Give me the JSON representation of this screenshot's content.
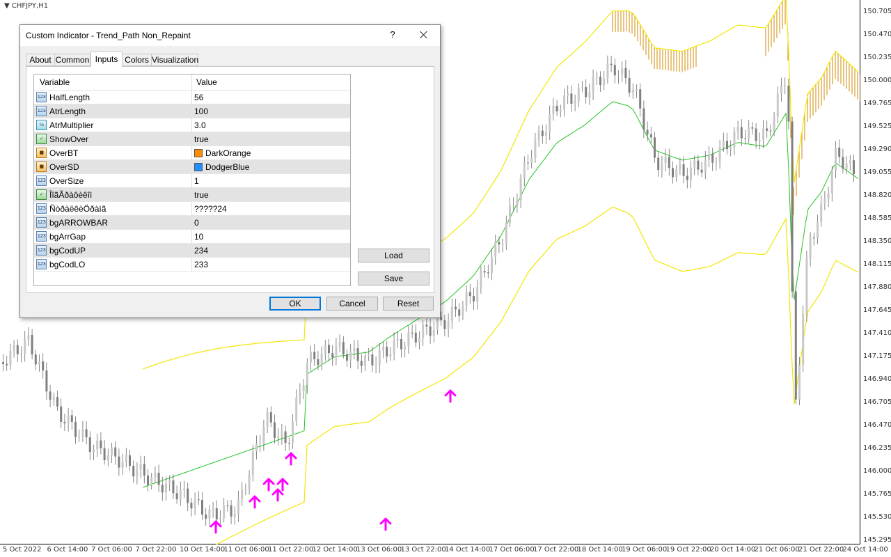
{
  "chart": {
    "symbol": "CHFJPY,H1",
    "price_axis": [
      "150.705",
      "150.470",
      "150.235",
      "150.000",
      "149.765",
      "149.525",
      "149.290",
      "149.055",
      "148.820",
      "148.585",
      "148.350",
      "148.115",
      "147.880",
      "147.645",
      "147.410",
      "147.175",
      "146.940",
      "146.705",
      "146.470",
      "146.235",
      "146.000",
      "145.765",
      "145.530",
      "145.295"
    ],
    "time_axis": [
      "5 Oct 2022",
      "6 Oct 14:00",
      "7 Oct 06:00",
      "7 Oct 22:00",
      "10 Oct 14:00",
      "11 Oct 06:00",
      "11 Oct 22:00",
      "12 Oct 14:00",
      "13 Oct 06:00",
      "13 Oct 22:00",
      "14 Oct 14:00",
      "17 Oct 06:00",
      "17 Oct 22:00",
      "18 Oct 14:00",
      "19 Oct 06:00",
      "19 Oct 22:00",
      "20 Oct 14:00",
      "21 Oct 06:00",
      "21 Oct 22:00",
      "24 Oct 14:00"
    ],
    "colors": {
      "upper_band": "#f2e600",
      "lower_band": "#f2e600",
      "mid_line": "#22c322",
      "over_bought": "#d08a00",
      "over_sold": "#1a8a94",
      "arrow": "#ff00ff",
      "candle_up": "#c8c8c8",
      "candle_down": "#808080"
    }
  },
  "dialog": {
    "title": "Custom Indicator - Trend_Path Non_Repaint",
    "help": "?",
    "tabs": [
      "About",
      "Common",
      "Inputs",
      "Colors",
      "Visualization"
    ],
    "active_tab": "Inputs",
    "grid": {
      "col_variable": "Variable",
      "col_value": "Value",
      "rows": [
        {
          "icon": "123",
          "name": "HalfLength",
          "value": "56"
        },
        {
          "icon": "123",
          "name": "AtrLength",
          "value": "100"
        },
        {
          "icon": "1/2",
          "name": "AtrMultiplier",
          "value": "3.0"
        },
        {
          "icon": "bool",
          "name": "ShowOver",
          "value": "true"
        },
        {
          "icon": "color",
          "name": "OverBT",
          "value": "DarkOrange",
          "swatch": "#ff8c00"
        },
        {
          "icon": "color",
          "name": "OverSD",
          "value": "DodgerBlue",
          "swatch": "#1e90ff"
        },
        {
          "icon": "123",
          "name": "OverSize",
          "value": "1"
        },
        {
          "icon": "bool",
          "name": "ÎîãÃðàôèêîì",
          "value": "true"
        },
        {
          "icon": "123",
          "name": "ÑòðàëêèÖðàìã",
          "value": "?????24"
        },
        {
          "icon": "123",
          "name": "bgARROWBAR",
          "value": "0"
        },
        {
          "icon": "123",
          "name": "bgArrGap",
          "value": "10"
        },
        {
          "icon": "123",
          "name": "bgCodUP",
          "value": "234"
        },
        {
          "icon": "123",
          "name": "bgCodLO",
          "value": "233"
        }
      ]
    },
    "buttons": {
      "load": "Load",
      "save": "Save",
      "ok": "OK",
      "cancel": "Cancel",
      "reset": "Reset"
    }
  }
}
